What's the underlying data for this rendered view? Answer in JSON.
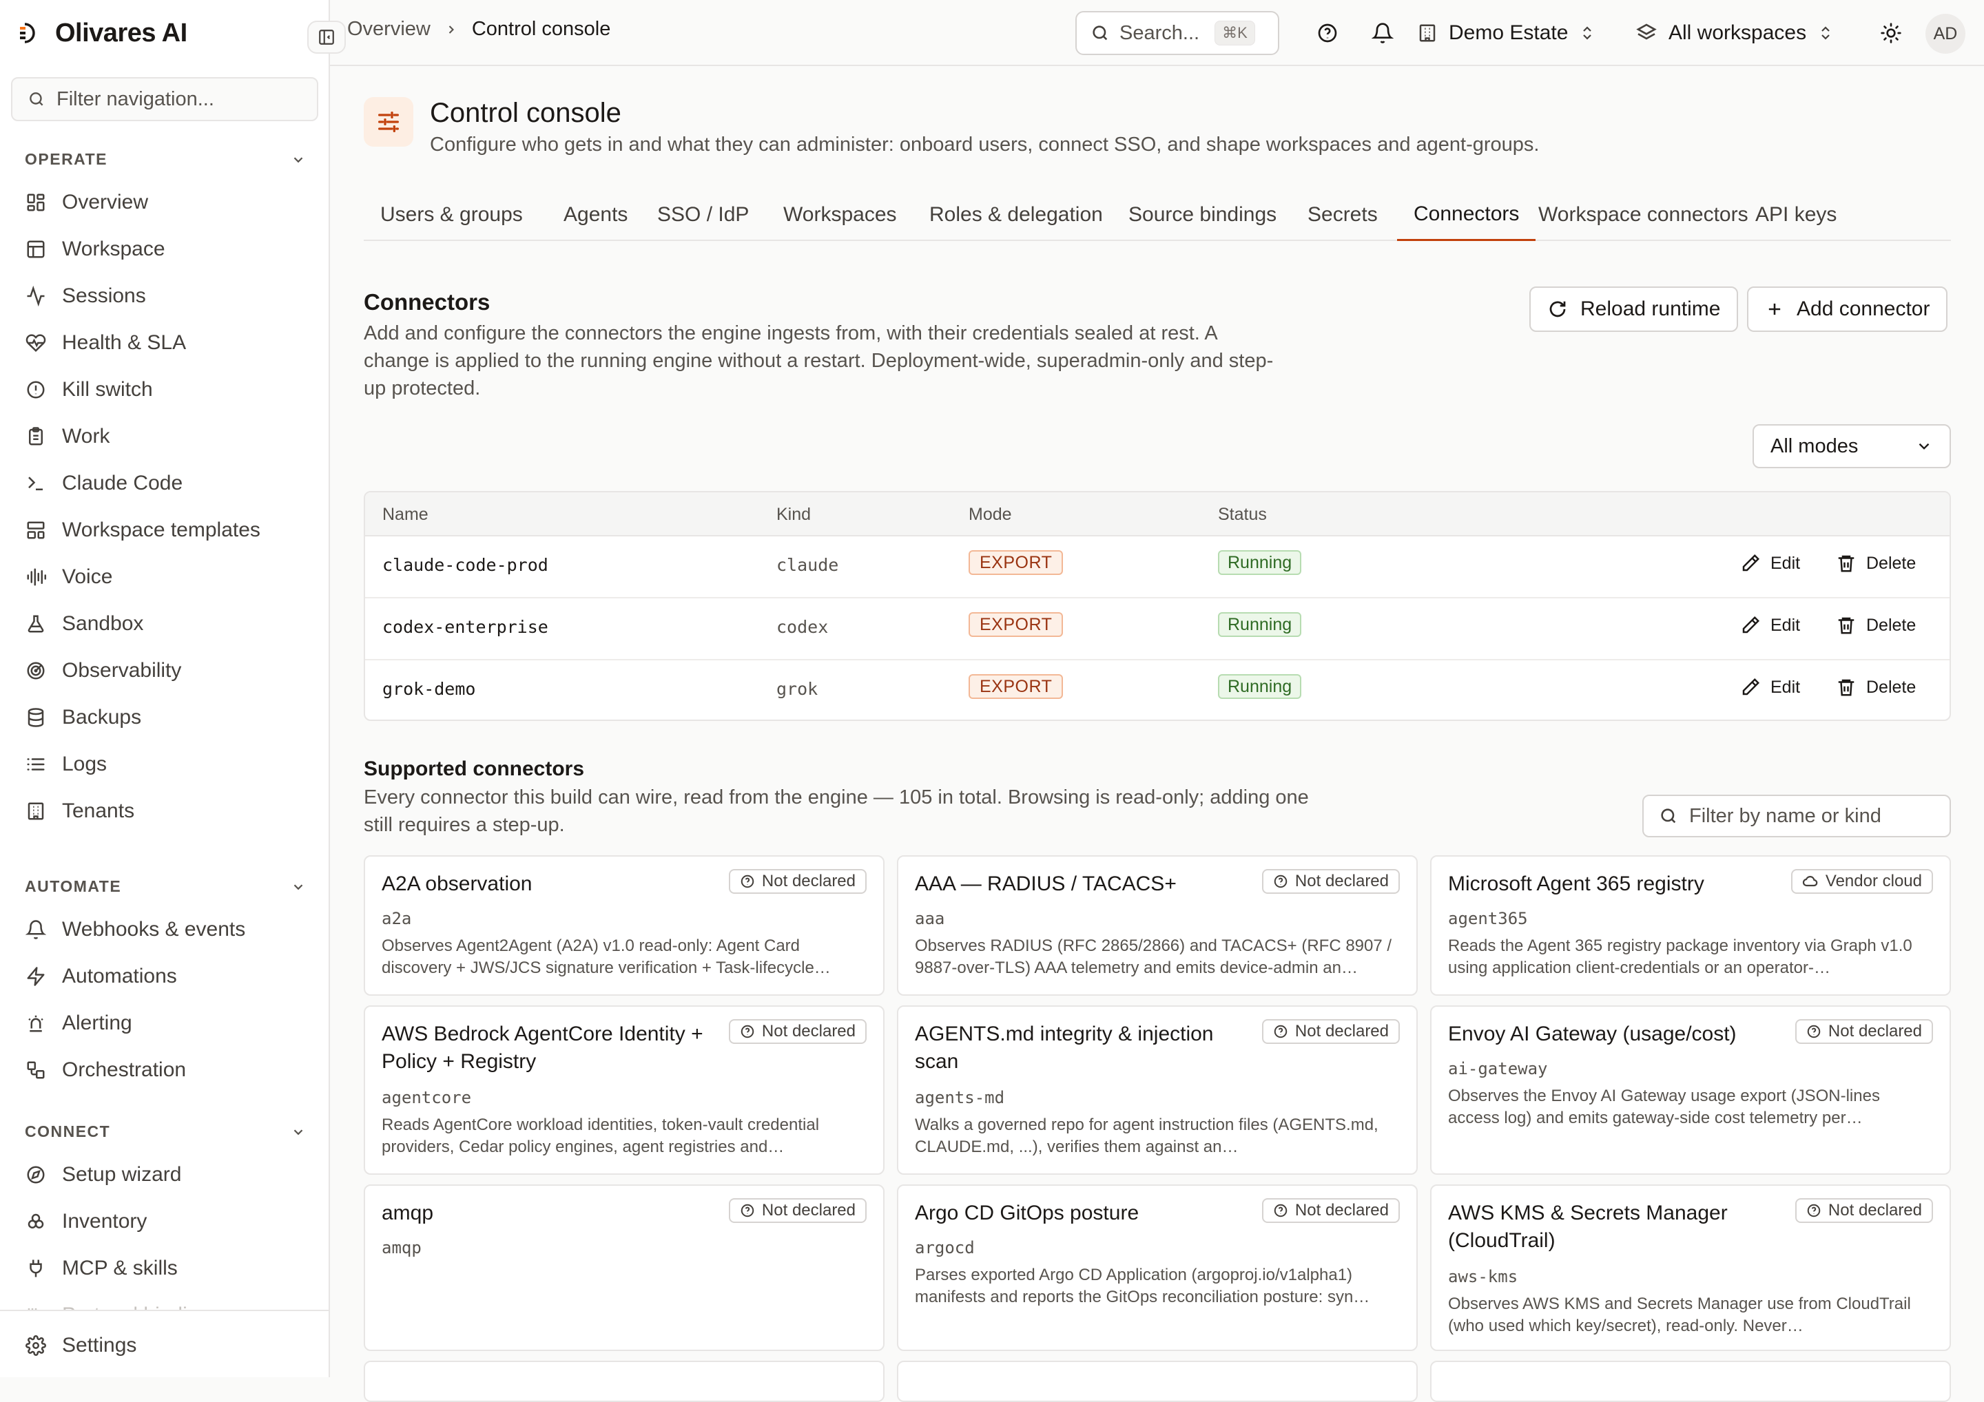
{
  "app": {
    "name": "Olivares AI"
  },
  "sidebar": {
    "filter_placeholder": "Filter navigation...",
    "sections": [
      {
        "label": "OPERATE",
        "items": [
          {
            "label": "Overview",
            "icon": "grid-icon"
          },
          {
            "label": "Workspace",
            "icon": "layout-icon"
          },
          {
            "label": "Sessions",
            "icon": "activity-icon"
          },
          {
            "label": "Health & SLA",
            "icon": "heart-pulse-icon"
          },
          {
            "label": "Kill switch",
            "icon": "alert-circle-icon"
          },
          {
            "label": "Work",
            "icon": "clipboard-icon"
          },
          {
            "label": "Claude Code",
            "icon": "terminal-icon"
          },
          {
            "label": "Workspace templates",
            "icon": "template-icon"
          },
          {
            "label": "Voice",
            "icon": "audio-lines-icon"
          },
          {
            "label": "Sandbox",
            "icon": "flask-icon"
          },
          {
            "label": "Observability",
            "icon": "radar-icon"
          },
          {
            "label": "Backups",
            "icon": "database-icon"
          },
          {
            "label": "Logs",
            "icon": "list-icon"
          },
          {
            "label": "Tenants",
            "icon": "building-icon"
          }
        ]
      },
      {
        "label": "AUTOMATE",
        "items": [
          {
            "label": "Webhooks & events",
            "icon": "bell-icon"
          },
          {
            "label": "Automations",
            "icon": "zap-icon"
          },
          {
            "label": "Alerting",
            "icon": "siren-icon"
          },
          {
            "label": "Orchestration",
            "icon": "workflow-icon"
          }
        ]
      },
      {
        "label": "CONNECT",
        "items": [
          {
            "label": "Setup wizard",
            "icon": "compass-icon"
          },
          {
            "label": "Inventory",
            "icon": "boxes-icon"
          },
          {
            "label": "MCP & skills",
            "icon": "plug-icon"
          },
          {
            "label": "Protocol bindings",
            "icon": "binding-icon"
          }
        ]
      }
    ],
    "settings_label": "Settings"
  },
  "topbar": {
    "breadcrumb": [
      "Overview",
      "Control console"
    ],
    "search_placeholder": "Search...",
    "search_shortcut": "⌘K",
    "estate": "Demo Estate",
    "workspaces": "All workspaces",
    "avatar_initials": "AD"
  },
  "page": {
    "title": "Control console",
    "subtitle": "Configure who gets in and what they can administer: onboard users, connect SSO, and shape workspaces and agent-groups.",
    "tabs": [
      "Users & groups",
      "Agents",
      "SSO / IdP",
      "Workspaces",
      "Roles & delegation",
      "Source bindings",
      "Secrets",
      "Connectors",
      "Workspace connectors",
      "API keys"
    ],
    "active_tab": "Connectors"
  },
  "connectors": {
    "title": "Connectors",
    "description": "Add and configure the connectors the engine ingests from, with their credentials sealed at rest. A change is applied to the running engine without a restart. Deployment-wide, superadmin-only and step-up protected.",
    "reload_label": "Reload runtime",
    "add_label": "Add connector",
    "mode_filter": "All modes",
    "columns": [
      "Name",
      "Kind",
      "Mode",
      "Status"
    ],
    "rows": [
      {
        "name": "claude-code-prod",
        "kind": "claude",
        "mode": "EXPORT",
        "status": "Running"
      },
      {
        "name": "codex-enterprise",
        "kind": "codex",
        "mode": "EXPORT",
        "status": "Running"
      },
      {
        "name": "grok-demo",
        "kind": "grok",
        "mode": "EXPORT",
        "status": "Running"
      }
    ],
    "edit_label": "Edit",
    "delete_label": "Delete"
  },
  "supported": {
    "title": "Supported connectors",
    "description": "Every connector this build can wire, read from the engine — 105 in total. Browsing is read-only; adding one still requires a step-up.",
    "filter_placeholder": "Filter by name or kind",
    "cards": [
      {
        "title": "A2A observation",
        "id": "a2a",
        "badge": "Not declared",
        "desc": "Observes Agent2Agent (A2A) v1.0 read-only: Agent Card discovery + JWS/JCS signature verification + Task-lifecycle…"
      },
      {
        "title": "AAA — RADIUS / TACACS+",
        "id": "aaa",
        "badge": "Not declared",
        "desc": "Observes RADIUS (RFC 2865/2866) and TACACS+ (RFC 8907 / 9887-over-TLS) AAA telemetry and emits device-admin an…"
      },
      {
        "title": "Microsoft Agent 365 registry",
        "id": "agent365",
        "badge": "Vendor cloud",
        "desc": "Reads the Agent 365 registry package inventory via Graph v1.0 using application client-credentials or an operator-…"
      },
      {
        "title": "AWS Bedrock AgentCore Identity + Policy + Registry",
        "id": "agentcore",
        "badge": "Not declared",
        "desc": "Reads AgentCore workload identities, token-vault credential providers, Cedar policy engines, agent registries and…"
      },
      {
        "title": "AGENTS.md integrity & injection scan",
        "id": "agents-md",
        "badge": "Not declared",
        "desc": "Walks a governed repo for agent instruction files (AGENTS.md, CLAUDE.md, ...), verifies them against an…"
      },
      {
        "title": "Envoy AI Gateway (usage/cost)",
        "id": "ai-gateway",
        "badge": "Not declared",
        "desc": "Observes the Envoy AI Gateway usage export (JSON-lines access log) and emits gateway-side cost telemetry per…"
      },
      {
        "title": "amqp",
        "id": "amqp",
        "badge": "Not declared",
        "desc": ""
      },
      {
        "title": "Argo CD GitOps posture",
        "id": "argocd",
        "badge": "Not declared",
        "desc": "Parses exported Argo CD Application (argoproj.io/v1alpha1) manifests and reports the GitOps reconciliation posture: syn…"
      },
      {
        "title": "AWS KMS & Secrets Manager (CloudTrail)",
        "id": "aws-kms",
        "badge": "Not declared",
        "desc": "Observes AWS KMS and Secrets Manager use from CloudTrail (who used which key/secret), read-only. Never…"
      }
    ]
  },
  "colors": {
    "accent": "#c2410c",
    "export_badge": "#9a3412",
    "running_badge": "#2f6b24"
  }
}
